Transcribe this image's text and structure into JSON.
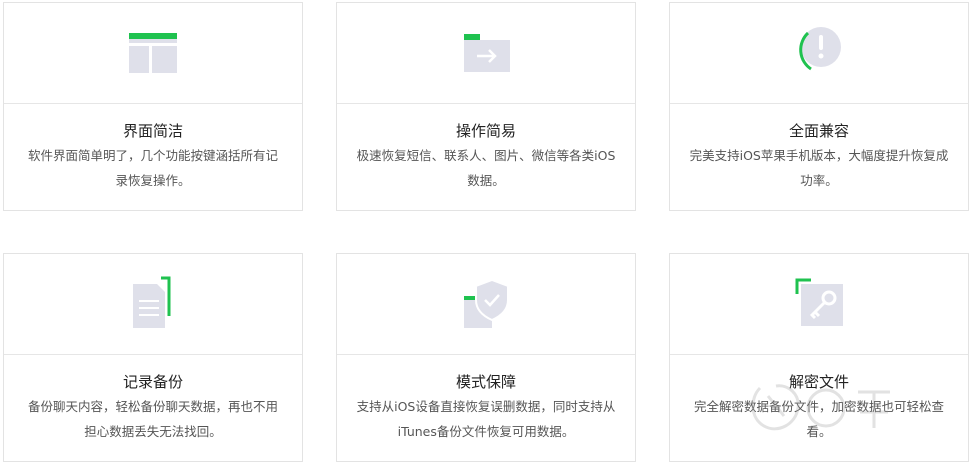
{
  "features": [
    {
      "icon": "layout-icon",
      "title": "界面简洁",
      "description": "软件界面简单明了，几个功能按键涵括所有记录恢复操作。"
    },
    {
      "icon": "folder-arrow-icon",
      "title": "操作简易",
      "description": "极速恢复短信、联系人、图片、微信等各类iOS数据。"
    },
    {
      "icon": "alert-circle-icon",
      "title": "全面兼容",
      "description": "完美支持iOS苹果手机版本，大幅度提升恢复成功率。"
    },
    {
      "icon": "document-icon",
      "title": "记录备份",
      "description": "备份聊天内容，轻松备份聊天数据，再也不用担心数据丢失无法找回。"
    },
    {
      "icon": "shield-check-icon",
      "title": "模式保障",
      "description": "支持从iOS设备直接恢复误删数据，同时支持从iTunes备份文件恢复可用数据。"
    },
    {
      "icon": "key-icon",
      "title": "解密文件",
      "description": "完全解密数据备份文件，加密数据也可轻松查看。"
    }
  ],
  "colors": {
    "accent": "#1fc24f",
    "icon_gray": "#dfe0ea",
    "border": "#e3e3e3"
  }
}
